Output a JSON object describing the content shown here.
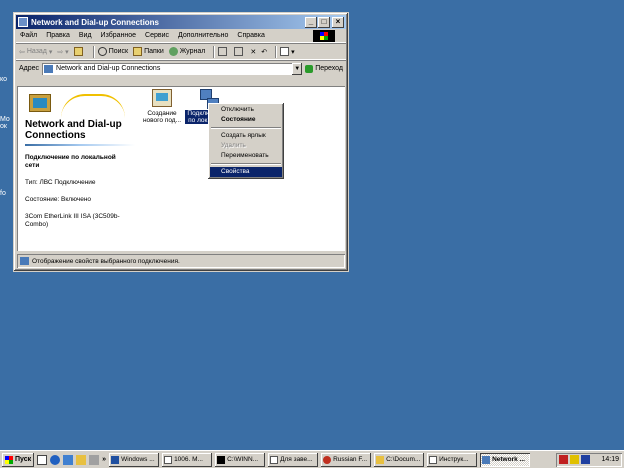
{
  "window": {
    "title": "Network and Dial-up Connections",
    "buttons": {
      "minimize": "_",
      "maximize": "□",
      "close": "×"
    }
  },
  "menu": [
    "Файл",
    "Правка",
    "Вид",
    "Избранное",
    "Сервис",
    "Дополнительно",
    "Справка"
  ],
  "toolbar": {
    "back": "Назад",
    "search": "Поиск",
    "folders": "Папки",
    "history": "Журнал"
  },
  "address": {
    "label": "Адрес",
    "value": "Network and Dial-up Connections",
    "go": "Переход"
  },
  "left_pane": {
    "title": "Network and Dial-up Connections",
    "selected_name": "Подключение по локальной сети",
    "type": "Тип: ЛВС Подключение",
    "status": "Состояние: Включено",
    "device": "3Com EtherLink III ISA (3C509b-Combo)"
  },
  "icons": [
    {
      "label": "Создание нового под..."
    },
    {
      "label": "Подключение по лок... сети"
    }
  ],
  "context_menu": {
    "items": [
      {
        "label": "Отключить"
      },
      {
        "label": "Состояние"
      },
      {
        "label": "Создать ярлык"
      },
      {
        "label": "Удалить"
      },
      {
        "label": "Переименовать"
      },
      {
        "label": "Свойства"
      }
    ]
  },
  "statusbar": {
    "text": "Отображение свойств выбранного подключения."
  },
  "taskbar": {
    "start": "Пуск",
    "more": "»",
    "tasks": [
      {
        "label": "Windows ..."
      },
      {
        "label": "1006. M..."
      },
      {
        "label": "C:\\WINN..."
      },
      {
        "label": "Для заве..."
      },
      {
        "label": "Russian F..."
      },
      {
        "label": "C:\\Docum..."
      },
      {
        "label": "Инструк..."
      },
      {
        "label": "Network ..."
      }
    ],
    "clock": "14:19"
  }
}
